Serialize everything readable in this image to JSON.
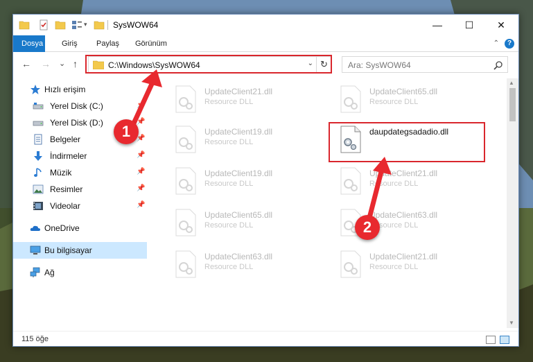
{
  "window": {
    "title": "SysWOW64",
    "minimize_glyph": "—",
    "maximize_glyph": "☐",
    "close_glyph": "✕"
  },
  "ribbon": {
    "tabs": [
      "Dosya",
      "Giriş",
      "Paylaş",
      "Görünüm"
    ],
    "help_glyph": "?",
    "collapse_glyph": "⌃"
  },
  "navigation": {
    "back_glyph": "←",
    "forward_glyph": "→",
    "recent_glyph": "⌄",
    "up_glyph": "↑"
  },
  "address_bar": {
    "path": "C:\\Windows\\SysWOW64",
    "dropdown_glyph": "⌄",
    "refresh_glyph": "↻"
  },
  "search": {
    "placeholder": "Ara: SysWOW64"
  },
  "sidebar": {
    "pin_glyph": "📌",
    "items": [
      {
        "label": "Hızlı erişim",
        "icon": "star-icon"
      },
      {
        "label": "Yerel Disk (C:)",
        "icon": "drive-icon"
      },
      {
        "label": "Yerel Disk (D:)",
        "icon": "drive-icon"
      },
      {
        "label": "Belgeler",
        "icon": "documents-icon"
      },
      {
        "label": "İndirmeler",
        "icon": "download-icon"
      },
      {
        "label": "Müzik",
        "icon": "music-icon"
      },
      {
        "label": "Resimler",
        "icon": "pictures-icon"
      },
      {
        "label": "Videolar",
        "icon": "videos-icon"
      },
      {
        "label": "OneDrive",
        "icon": "cloud-icon"
      },
      {
        "label": "Bu bilgisayar",
        "icon": "computer-icon"
      },
      {
        "label": "Ağ",
        "icon": "network-icon"
      }
    ]
  },
  "files": [
    {
      "name": "UpdateClient21.dll",
      "type": "Resource DLL"
    },
    {
      "name": "UpdateClient65.dll",
      "type": "Resource DLL"
    },
    {
      "name": "UpdateClient19.dll",
      "type": "Resource DLL"
    },
    {
      "name": "daupdategsadadio.dll",
      "type": ""
    },
    {
      "name": "UpdateClient19.dll",
      "type": "Resource DLL"
    },
    {
      "name": "UpdateClient21.dll",
      "type": "Resource DLL"
    },
    {
      "name": "UpdateClient65.dll",
      "type": "Resource DLL"
    },
    {
      "name": "UpdateClient63.dll",
      "type": "Resource DLL"
    },
    {
      "name": "UpdateClient63.dll",
      "type": "Resource DLL"
    },
    {
      "name": "UpdateClient21.dll",
      "type": "Resource DLL"
    }
  ],
  "status": {
    "item_count": "115 öğe"
  },
  "annotations": {
    "step_1": "1",
    "step_2": "2",
    "accent_color": "#e8292f"
  }
}
